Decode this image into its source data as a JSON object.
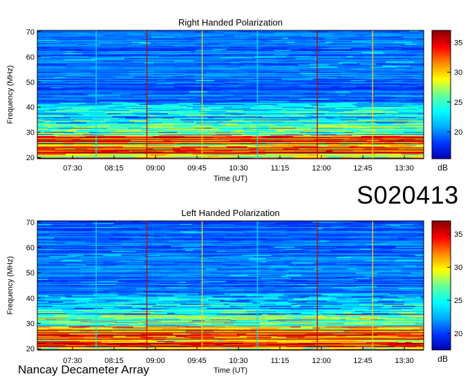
{
  "observation_label": "S020413",
  "footer": "Nancay Decameter Array",
  "chart_data": [
    {
      "type": "heatmap",
      "title": "Right Handed Polarization",
      "xlabel": "Time (UT)",
      "ylabel": "Frequency (MHz)",
      "x_tick_labels": [
        "07:30",
        "08:15",
        "09:00",
        "09:45",
        "10:30",
        "11:15",
        "12:00",
        "12:45",
        "13:30"
      ],
      "y_tick_labels": [
        "20",
        "30",
        "40",
        "50",
        "60",
        "70"
      ],
      "ylim": [
        19.5,
        70.5
      ],
      "colorbar": {
        "label": "dB",
        "tick_labels": [
          "20",
          "25",
          "30",
          "35"
        ],
        "range": [
          15.5,
          37
        ]
      },
      "colormap": [
        "#0000b0",
        "#0033ff",
        "#00aaff",
        "#00ffff",
        "#66ff99",
        "#ffff00",
        "#ff8800",
        "#ff0000",
        "#8b0000"
      ],
      "spectral_structure": {
        "intense_band_mhz": [
          20,
          29
        ],
        "moderate_band_mhz": [
          29,
          42
        ],
        "background": "quiet blue"
      },
      "vertical_stripes": [
        {
          "time": "07:55",
          "color": "#00e0ff"
        },
        {
          "time": "08:50",
          "color": "#cc0000"
        },
        {
          "time": "09:50",
          "color": "#ffd000"
        },
        {
          "time": "10:50",
          "color": "#00e0ff"
        },
        {
          "time": "11:55",
          "color": "#cc0000"
        },
        {
          "time": "12:55",
          "color": "#ffd000"
        }
      ]
    },
    {
      "type": "heatmap",
      "title": "Left Handed Polarization",
      "xlabel": "Time (UT)",
      "ylabel": "Frequency (MHz)",
      "x_tick_labels": [
        "07:30",
        "08:15",
        "09:00",
        "09:45",
        "10:30",
        "11:15",
        "12:00",
        "12:45",
        "13:30"
      ],
      "y_tick_labels": [
        "20",
        "30",
        "40",
        "50",
        "60",
        "70"
      ],
      "ylim": [
        19.5,
        70.5
      ],
      "colorbar": {
        "label": "dB",
        "tick_labels": [
          "20",
          "25",
          "30",
          "35"
        ],
        "range": [
          17.5,
          37
        ]
      },
      "colormap": [
        "#0000b0",
        "#0033ff",
        "#00aaff",
        "#00ffff",
        "#66ff99",
        "#ffff00",
        "#ff8800",
        "#ff0000",
        "#8b0000"
      ],
      "spectral_structure": {
        "intense_band_mhz": [
          20,
          29
        ],
        "moderate_band_mhz": [
          29,
          42
        ],
        "background": "quiet blue"
      },
      "vertical_stripes": [
        {
          "time": "07:55",
          "color": "#00e0ff"
        },
        {
          "time": "08:50",
          "color": "#cc0000"
        },
        {
          "time": "09:50",
          "color": "#ffd000"
        },
        {
          "time": "10:50",
          "color": "#00e0ff"
        },
        {
          "time": "11:55",
          "color": "#cc0000"
        },
        {
          "time": "12:55",
          "color": "#ffd000"
        }
      ]
    }
  ]
}
